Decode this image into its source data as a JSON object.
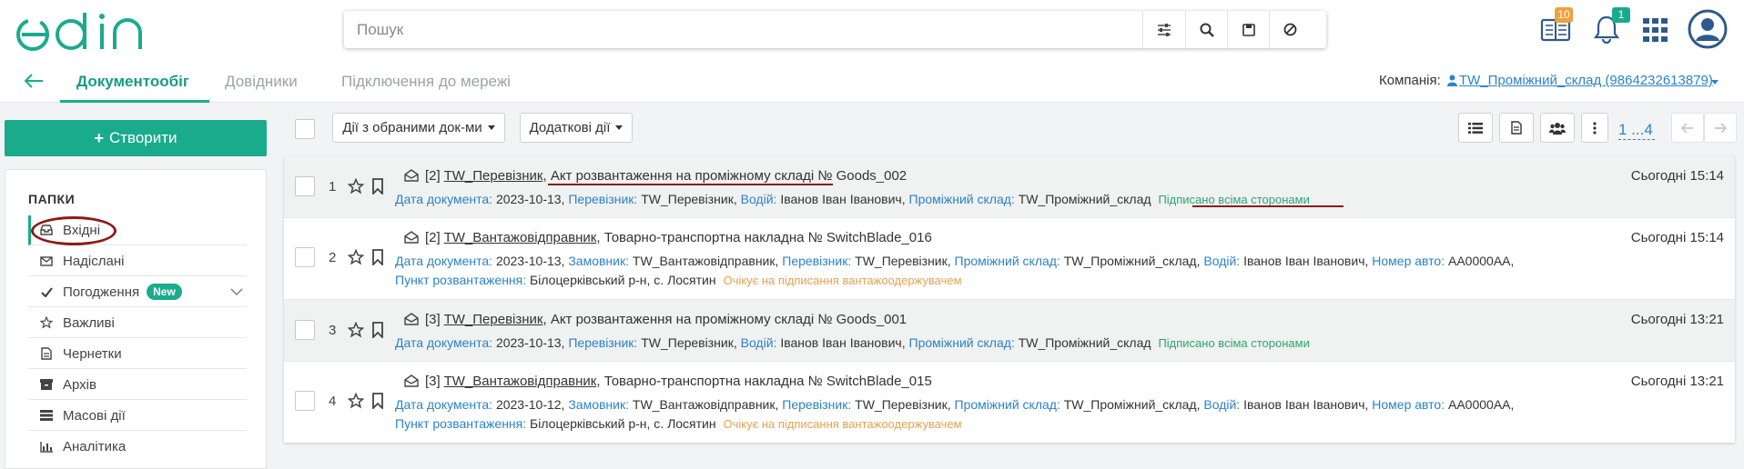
{
  "header": {
    "logo": "edin",
    "search": {
      "placeholder": "Пошук"
    },
    "badges": {
      "docs": "10",
      "notifications": "1"
    }
  },
  "nav": {
    "tabs": [
      {
        "label": "Документообіг"
      },
      {
        "label": "Довідники"
      },
      {
        "label": "Підключення до мережі"
      }
    ],
    "company_label": "Компанія:",
    "company_value": "TW_Проміжний_склад (9864232613879)"
  },
  "sidebar": {
    "create_label": "Створити",
    "folders_title": "ПАПКИ",
    "folders": [
      {
        "label": "Вхідні",
        "icon": "inbox-icon"
      },
      {
        "label": "Надіслані",
        "icon": "envelope-icon"
      },
      {
        "label": "Погодження",
        "icon": "check-icon",
        "badge": "New"
      },
      {
        "label": "Важливі",
        "icon": "star-icon"
      },
      {
        "label": "Чернетки",
        "icon": "draft-icon"
      },
      {
        "label": "Архів",
        "icon": "archive-icon"
      },
      {
        "label": "Масові дії",
        "icon": "bulk-icon"
      },
      {
        "label": "Аналітика",
        "icon": "chart-icon"
      }
    ]
  },
  "toolbar": {
    "bulk_actions": "Дії з обраними док-ми",
    "extra_actions": "Додаткові дії",
    "pager": "1 ...4"
  },
  "labels": {
    "doc_date": "Дата документа:",
    "carrier": "Перевізник:",
    "driver": "Водій:",
    "warehouse": "Проміжний склад:",
    "customer": "Замовник:",
    "car_no": "Номер авто:",
    "unload_point": "Пункт розвантаження:"
  },
  "documents": [
    {
      "num": "1",
      "count": "[2]",
      "sender": "TW_Перевізник",
      "title": "Акт розвантаження на проміжному складі",
      "doc_no": "№ Goods_002",
      "date": "2023-10-13,",
      "carrier": "TW_Перевізник,",
      "driver": "Іванов Іван Іванович,",
      "warehouse": "TW_Проміжний_склад",
      "status": "Підписано всіма сторонами",
      "time": "Сьогодні 15:14"
    },
    {
      "num": "2",
      "count": "[2]",
      "sender": "TW_Вантажовідправник",
      "title": "Товарно-транспортна накладна",
      "doc_no": "№ SwitchBlade_016",
      "date": "2023-10-13,",
      "customer": "TW_Вантажовідправник,",
      "carrier": "TW_Перевізник,",
      "warehouse": "TW_Проміжний_склад,",
      "driver": "Іванов Іван Іванович,",
      "car_no": "AA0000AA,",
      "unload_point": "Білоцерківський р-н, с. Лосятин",
      "status": "Очікує на підписання вантажоодержувачем",
      "time": "Сьогодні 15:14"
    },
    {
      "num": "3",
      "count": "[3]",
      "sender": "TW_Перевізник",
      "title": "Акт розвантаження на проміжному складі",
      "doc_no": "№ Goods_001",
      "date": "2023-10-13,",
      "carrier": "TW_Перевізник,",
      "driver": "Іванов Іван Іванович,",
      "warehouse": "TW_Проміжний_склад",
      "status": "Підписано всіма сторонами",
      "time": "Сьогодні 13:21"
    },
    {
      "num": "4",
      "count": "[3]",
      "sender": "TW_Вантажовідправник",
      "title": "Товарно-транспортна накладна",
      "doc_no": "№ SwitchBlade_015",
      "date": "2023-10-12,",
      "customer": "TW_Вантажовідправник,",
      "carrier": "TW_Перевізник,",
      "warehouse": "TW_Проміжний_склад,",
      "driver": "Іванов Іван Іванович,",
      "car_no": "AA0000AA,",
      "unload_point": "Білоцерківський р-н, с. Лосятин",
      "status": "Очікує на підписання вантажоодержувачем",
      "time": "Сьогодні 13:21"
    }
  ],
  "colors": {
    "brand": "#1aab8d",
    "link_blue": "#2b83c6",
    "status_green": "#2ba676",
    "status_orange": "#e9a04e",
    "annotation_red": "#8c1b18"
  }
}
